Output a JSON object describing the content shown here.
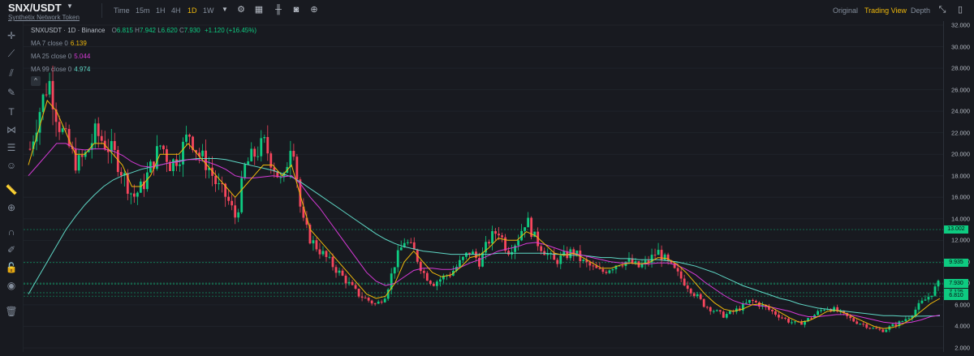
{
  "header": {
    "pair": "SNX/USDT",
    "pair_sub": "Synthetix Network Token",
    "timeframes": [
      {
        "label": "Time",
        "active": false
      },
      {
        "label": "15m",
        "active": false
      },
      {
        "label": "1H",
        "active": false
      },
      {
        "label": "4H",
        "active": false
      },
      {
        "label": "1D",
        "active": true
      },
      {
        "label": "1W",
        "active": false
      }
    ],
    "views": [
      {
        "label": "Original",
        "active": false
      },
      {
        "label": "Trading View",
        "active": true
      },
      {
        "label": "Depth",
        "active": false
      }
    ]
  },
  "legend": {
    "title": "SNXUSDT · 1D · Binance",
    "ohlc": {
      "o_label": "O",
      "o": "6.815",
      "h_label": "H",
      "h": "7.942",
      "l_label": "L",
      "l": "6.620",
      "c_label": "C",
      "c": "7.930",
      "change": "+1.120 (+16.45%)"
    },
    "ma": [
      {
        "label": "MA 7 close 0",
        "value": "6.139",
        "color": "#f0b90b"
      },
      {
        "label": "MA 25 close 0",
        "value": "5.044",
        "color": "#d63ad6"
      },
      {
        "label": "MA 99 close 0",
        "value": "4.974",
        "color": "#5fd8c6"
      }
    ]
  },
  "colors": {
    "up": "#0ecb81",
    "down": "#f6465d",
    "accent": "#f0b90b",
    "bg": "#181a20"
  },
  "chart_data": {
    "type": "candlestick",
    "ylim": [
      2.0,
      32.0
    ],
    "y_ticks": [
      "32.000",
      "30.000",
      "28.000",
      "26.000",
      "24.000",
      "22.000",
      "20.000",
      "18.000",
      "16.000",
      "14.000",
      "12.000",
      "10.000",
      "8.000",
      "6.000",
      "4.000",
      "2.000"
    ],
    "y_tick_values": [
      32,
      30,
      28,
      26,
      24,
      22,
      20,
      18,
      16,
      14,
      12,
      10,
      8,
      6,
      4,
      2
    ],
    "price_levels": [
      {
        "label": "13.002",
        "value": 13.002,
        "color": "#0ecb81"
      },
      {
        "label": "9.935",
        "value": 9.935,
        "color": "#0ecb81"
      },
      {
        "label": "8.019",
        "value": 8.019,
        "color": "#0ecb81"
      },
      {
        "label": "7.930",
        "value": 7.93,
        "color": "#0ecb81"
      },
      {
        "label": "7.125",
        "value": 7.125,
        "color": "#0ecb81"
      },
      {
        "label": "6.810",
        "value": 6.81,
        "color": "#0ecb81"
      }
    ],
    "close_path": [
      20.5,
      24,
      27,
      23,
      21,
      19,
      20,
      22,
      21,
      20,
      18,
      16,
      17,
      19,
      21,
      19,
      20,
      22,
      20,
      19,
      17,
      16,
      14,
      19,
      20,
      21,
      19,
      17,
      22,
      14,
      12,
      11,
      10,
      9,
      8,
      7,
      6.5,
      6,
      7,
      10,
      12,
      11,
      9,
      8,
      8.5,
      9,
      10,
      11,
      10,
      12,
      13,
      11,
      12,
      14,
      12,
      11,
      10,
      10.5,
      11,
      10,
      9.5,
      9,
      9.5,
      10,
      10,
      9.5,
      10,
      11,
      10,
      9,
      8,
      7,
      6,
      5.5,
      5,
      5.3,
      5.8,
      6.4,
      6,
      5.5,
      5,
      4.5,
      4.2,
      4.6,
      5.2,
      5.8,
      5.5,
      5,
      4.5,
      4.2,
      3.8,
      3.6,
      4,
      4.4,
      5,
      6,
      6.8,
      7.9
    ],
    "ma7_path": [
      19,
      22,
      25,
      24,
      22,
      20,
      20,
      21,
      21,
      20,
      19,
      17,
      17,
      18,
      20,
      20,
      20,
      21,
      20,
      19,
      18,
      17,
      16,
      17,
      18,
      19,
      19,
      18,
      19,
      16,
      13,
      12,
      11,
      10,
      9,
      8,
      7,
      6.6,
      6.8,
      8,
      10,
      11,
      10,
      9,
      8.6,
      8.8,
      9.5,
      10.4,
      10.6,
      11.3,
      12.2,
      12,
      12,
      12.8,
      12.4,
      11.6,
      10.8,
      10.6,
      10.8,
      10.4,
      9.9,
      9.4,
      9.4,
      9.7,
      9.9,
      9.8,
      9.9,
      10.4,
      10.3,
      9.8,
      9,
      8,
      7,
      6.2,
      5.6,
      5.4,
      5.6,
      6,
      6.1,
      5.8,
      5.3,
      4.8,
      4.4,
      4.5,
      4.9,
      5.4,
      5.5,
      5.2,
      4.8,
      4.4,
      4,
      3.8,
      3.9,
      4.2,
      4.7,
      5.4,
      6.1,
      6.6
    ],
    "ma25_path": [
      18,
      19,
      20,
      21,
      21,
      20.5,
      20.4,
      20.5,
      20.5,
      20.3,
      19.9,
      19.3,
      18.9,
      18.8,
      19,
      19.2,
      19.3,
      19.5,
      19.5,
      19.3,
      19,
      18.6,
      18,
      17.8,
      17.8,
      17.9,
      18,
      17.9,
      18,
      17.2,
      16,
      15,
      13.8,
      12.6,
      11.4,
      10.2,
      9,
      8.2,
      7.8,
      8,
      8.6,
      9.2,
      9.4,
      9.4,
      9.3,
      9.3,
      9.5,
      9.9,
      10.2,
      10.6,
      11,
      11.2,
      11.4,
      11.7,
      11.8,
      11.6,
      11.3,
      11,
      10.8,
      10.6,
      10.4,
      10.2,
      10,
      9.9,
      9.9,
      9.8,
      9.8,
      9.9,
      9.9,
      9.7,
      9.3,
      8.8,
      8.1,
      7.5,
      6.9,
      6.4,
      6.1,
      6,
      5.9,
      5.8,
      5.6,
      5.4,
      5.1,
      4.9,
      4.9,
      5,
      5.1,
      5.1,
      5,
      4.8,
      4.6,
      4.4,
      4.3,
      4.3,
      4.4,
      4.6,
      4.9,
      5.044
    ],
    "ma99_path": [
      7,
      8.5,
      10,
      11.5,
      13,
      14.2,
      15.3,
      16.2,
      17,
      17.6,
      18,
      18.3,
      18.6,
      18.8,
      19,
      19.2,
      19.4,
      19.5,
      19.6,
      19.6,
      19.6,
      19.5,
      19.3,
      19.1,
      18.9,
      18.7,
      18.5,
      18.2,
      17.9,
      17.4,
      16.8,
      16.2,
      15.6,
      15,
      14.4,
      13.8,
      13.2,
      12.6,
      12.1,
      11.7,
      11.4,
      11.2,
      11,
      10.9,
      10.8,
      10.7,
      10.7,
      10.7,
      10.7,
      10.7,
      10.8,
      10.8,
      10.8,
      10.8,
      10.8,
      10.8,
      10.7,
      10.7,
      10.6,
      10.6,
      10.5,
      10.4,
      10.4,
      10.3,
      10.3,
      10.2,
      10.2,
      10.2,
      10.1,
      10,
      9.8,
      9.6,
      9.3,
      9,
      8.6,
      8.2,
      7.8,
      7.5,
      7.2,
      6.9,
      6.6,
      6.4,
      6.1,
      5.9,
      5.7,
      5.6,
      5.5,
      5.4,
      5.3,
      5.2,
      5.1,
      5,
      5,
      4.95,
      4.95,
      4.95,
      4.97,
      4.974
    ]
  }
}
